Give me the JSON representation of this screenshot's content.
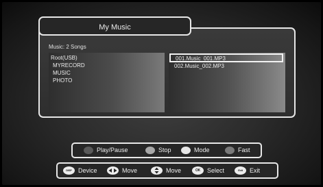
{
  "window": {
    "title": "My Music"
  },
  "browser": {
    "song_count": "Music: 2 Songs",
    "folders": [
      "Root(USB)",
      "MYRECORD",
      "MUSIC",
      "PHOTO"
    ],
    "files": [
      {
        "name": "001.Music_001.MP3",
        "selected": true
      },
      {
        "name": "002.Music_002.MP3",
        "selected": false
      }
    ]
  },
  "color_keys": [
    {
      "label": "Play/Pause",
      "color": "#5a5a5a",
      "icon": "gray-dot-icon"
    },
    {
      "label": "Stop",
      "color": "#a8a8a8",
      "icon": "light-gray-dot-icon"
    },
    {
      "label": "Mode",
      "color": "#e6e6e6",
      "icon": "white-dot-icon"
    },
    {
      "label": "Fast",
      "color": "#7a7a7a",
      "icon": "mid-gray-dot-icon"
    }
  ],
  "help": [
    {
      "icon": "disp-button-icon",
      "icon_text": "DISP",
      "label": "Device"
    },
    {
      "icon": "left-right-arrows-icon",
      "label": "Move"
    },
    {
      "icon": "up-down-arrows-icon",
      "label": "Move"
    },
    {
      "icon": "ok-button-icon",
      "icon_text": "OK",
      "label": "Select"
    },
    {
      "icon": "exit-button-icon",
      "icon_text": "Exit",
      "label": "Exit"
    }
  ]
}
